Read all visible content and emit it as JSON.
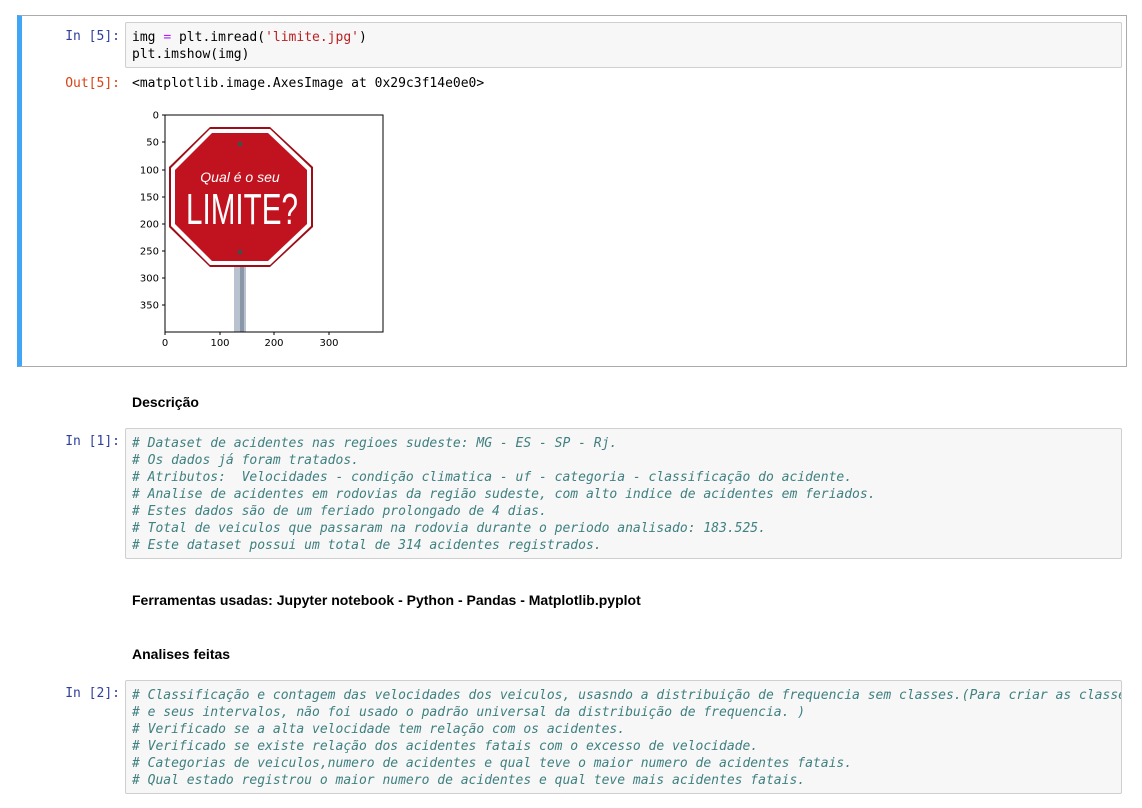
{
  "cell5": {
    "in_prompt": "In [5]:",
    "code_line1_a": "img ",
    "code_line1_eq": "=",
    "code_line1_b": " plt.imread(",
    "code_line1_str": "'limite.jpg'",
    "code_line1_c": ")",
    "code_line2": "plt.imshow(img)",
    "out_prompt": "Out[5]:",
    "out_text": "<matplotlib.image.AxesImage at 0x29c3f14e0e0>"
  },
  "plot": {
    "sign_line1": "Qual é o seu",
    "sign_line2": "LIMITE?",
    "y_ticks": [
      "0",
      "50",
      "100",
      "150",
      "200",
      "250",
      "300",
      "350"
    ],
    "x_ticks": [
      "0",
      "100",
      "200",
      "300"
    ],
    "colors": {
      "sign_red": "#c1121f",
      "sign_border": "#ffffff",
      "pole": "#a7b4c2"
    }
  },
  "md1": {
    "heading": "Descrição"
  },
  "cell1": {
    "in_prompt": "In [1]:",
    "lines": [
      "# Dataset de acidentes nas regioes sudeste: MG - ES - SP - Rj.",
      "# Os dados já foram tratados.",
      "# Atributos:  Velocidades - condição climatica - uf - categoria - classificação do acidente.",
      "# Analise de acidentes em rodovias da região sudeste, com alto indice de acidentes em feriados.",
      "# Estes dados são de um feriado prolongado de 4 dias.",
      "# Total de veiculos que passaram na rodovia durante o periodo analisado: 183.525.",
      "# Este dataset possui um total de 314 acidentes registrados."
    ]
  },
  "md2": {
    "text": "Ferramentas usadas: Jupyter notebook - Python - Pandas - Matplotlib.pyplot"
  },
  "md3": {
    "heading": "Analises feitas"
  },
  "cell2": {
    "in_prompt": "In [2]:",
    "lines": [
      "# Classificação e contagem das velocidades dos veiculos, usasndo a distribuição de frequencia sem classes.(Para criar as classes",
      "# e seus intervalos, não foi usado o padrão universal da distribuição de frequencia. )",
      "# Verificado se a alta velocidade tem relação com os acidentes.",
      "# Verificado se existe relação dos acidentes fatais com o excesso de velocidade.",
      "# Categorias de veiculos,numero de acidentes e qual teve o maior numero de acidentes fatais.",
      "# Qual estado registrou o maior numero de acidentes e qual teve mais acidentes fatais."
    ]
  }
}
